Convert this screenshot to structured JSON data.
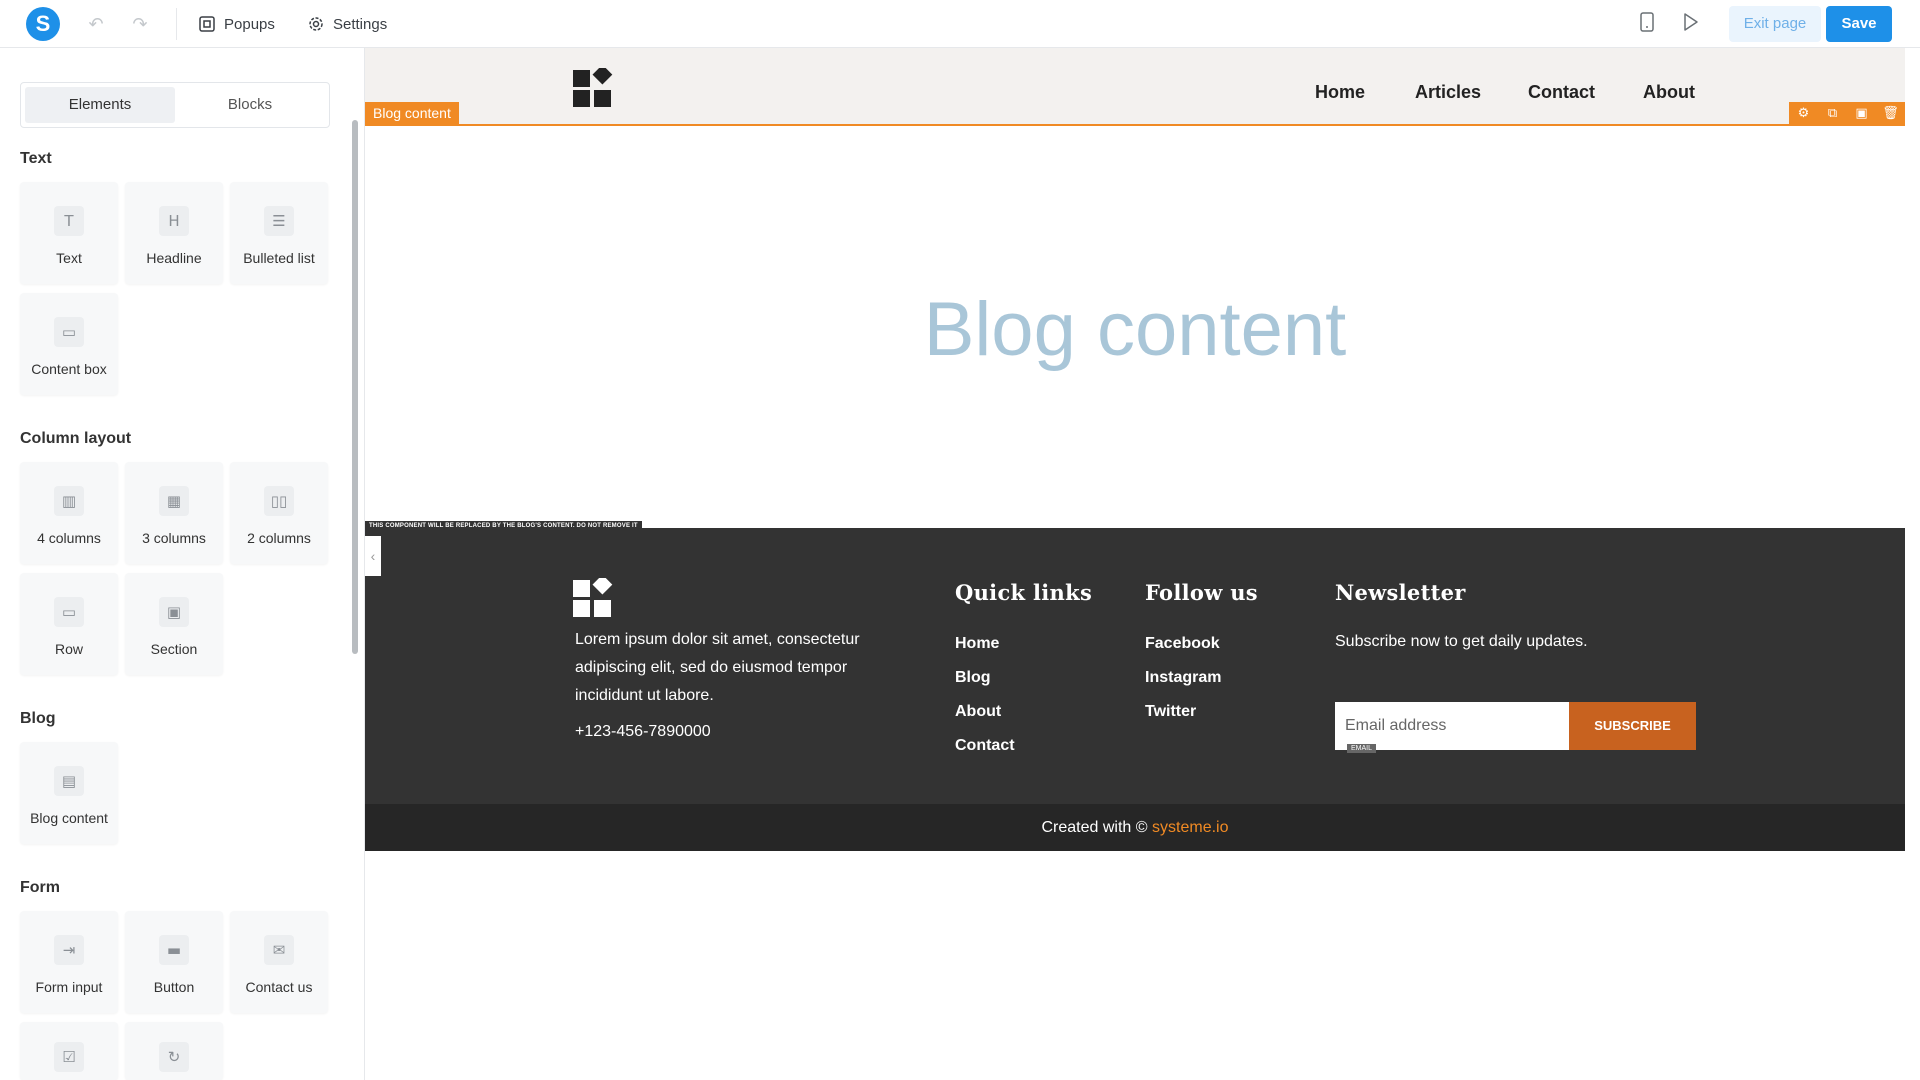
{
  "topbar": {
    "logo_letter": "S",
    "popups_label": "Popups",
    "settings_label": "Settings",
    "exit_label": "Exit page",
    "save_label": "Save",
    "brand_color": "#1e90e8"
  },
  "sidebar": {
    "tabs": [
      "Elements",
      "Blocks"
    ],
    "sections": {
      "text": {
        "title": "Text",
        "items": [
          {
            "label": "Text",
            "icon": "text-icon"
          },
          {
            "label": "Headline",
            "icon": "headline-icon"
          },
          {
            "label": "Bulleted list",
            "icon": "list-icon"
          },
          {
            "label": "Content box",
            "icon": "box-icon"
          }
        ]
      },
      "columns": {
        "title": "Column layout",
        "items": [
          {
            "label": "4 columns",
            "icon": "four-columns-icon"
          },
          {
            "label": "3 columns",
            "icon": "three-columns-icon"
          },
          {
            "label": "2 columns",
            "icon": "two-columns-icon"
          },
          {
            "label": "Row",
            "icon": "row-icon"
          },
          {
            "label": "Section",
            "icon": "section-icon"
          }
        ]
      },
      "blog": {
        "title": "Blog",
        "items": [
          {
            "label": "Blog content",
            "icon": "blog-content-icon"
          }
        ]
      },
      "form": {
        "title": "Form",
        "items": [
          {
            "label": "Form input",
            "icon": "form-input-icon"
          },
          {
            "label": "Button",
            "icon": "button-icon"
          },
          {
            "label": "Contact us",
            "icon": "contact-icon"
          }
        ]
      }
    }
  },
  "page": {
    "nav": [
      "Home",
      "Articles",
      "Contact",
      "About"
    ],
    "header_tag": "Blog content",
    "blog_title": "Blog content",
    "accent_color": "#f08a24",
    "footer": {
      "warning": "THIS COMPONENT WILL BE REPLACED BY THE BLOG'S CONTENT. DO NOT REMOVE IT",
      "about": "Lorem ipsum dolor sit amet, consectetur adipiscing elit, sed do eiusmod tempor incididunt ut labore.",
      "phone": "+123-456-7890000",
      "quick_links_title": "Quick links",
      "quick_links": [
        "Home",
        "Blog",
        "About",
        "Contact"
      ],
      "follow_title": "Follow us",
      "follow_links": [
        "Facebook",
        "Instagram",
        "Twitter"
      ],
      "newsletter_title": "Newsletter",
      "newsletter_text": "Subscribe now to get daily updates.",
      "email_placeholder": "Email address",
      "email_tag": "EMAIL",
      "subscribe_label": "SUBSCRIBE",
      "copyright_prefix": "Created with ©",
      "copyright_brand": "systeme.io"
    }
  }
}
